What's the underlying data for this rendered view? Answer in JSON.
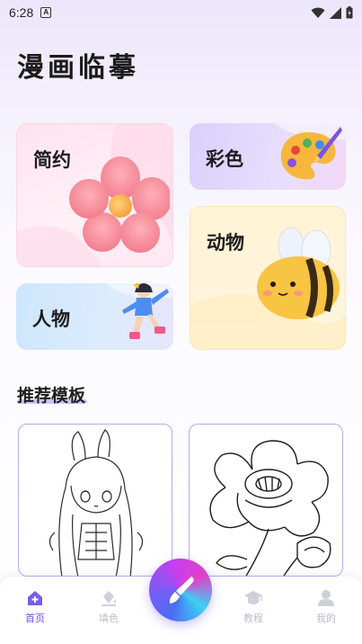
{
  "status_bar": {
    "time": "6:28",
    "notification_badge": "A"
  },
  "app_title": "漫画临摹",
  "categories": [
    {
      "label": "简约"
    },
    {
      "label": "彩色"
    },
    {
      "label": "动物"
    },
    {
      "label": "人物"
    }
  ],
  "section_title": "推荐模板",
  "bottom_nav": {
    "items": [
      {
        "label": "首页",
        "icon": "home-icon",
        "active": true
      },
      {
        "label": "填色",
        "icon": "paint-bucket-icon",
        "active": false
      },
      {
        "label": "教程",
        "icon": "graduation-cap-icon",
        "active": false
      },
      {
        "label": "我的",
        "icon": "person-icon",
        "active": false
      }
    ],
    "center_icon": "brush-icon"
  },
  "colors": {
    "accent": "#6b50d8",
    "inactive": "#bcbcc8"
  }
}
